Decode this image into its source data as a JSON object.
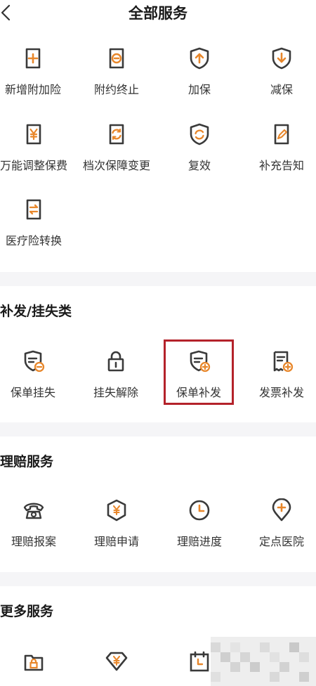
{
  "header": {
    "title": "全部服务",
    "back_icon": "chevron-left-icon"
  },
  "colors": {
    "accent": "#e8872b",
    "icon_stroke": "#3a3a3a",
    "highlight": "#b4222a",
    "divider": "#f5f5f7"
  },
  "change_section": {
    "items": [
      {
        "label": "新增附加险",
        "icon": "plus-doc-icon"
      },
      {
        "label": "附约终止",
        "icon": "minus-doc-icon"
      },
      {
        "label": "加保",
        "icon": "shield-up-icon"
      },
      {
        "label": "减保",
        "icon": "shield-down-icon"
      },
      {
        "label": "万能调整保费",
        "icon": "yen-doc-icon"
      },
      {
        "label": "档次保障变更",
        "icon": "cycle-doc-icon"
      },
      {
        "label": "复效",
        "icon": "shield-refresh-icon"
      },
      {
        "label": "补充告知",
        "icon": "pen-doc-icon"
      },
      {
        "label": "医疗险转换",
        "icon": "swap-doc-icon"
      }
    ]
  },
  "reissue_section": {
    "title": "补发/挂失类",
    "items": [
      {
        "label": "保单挂失",
        "icon": "policy-minus-icon"
      },
      {
        "label": "挂失解除",
        "icon": "unlock-icon"
      },
      {
        "label": "保单补发",
        "icon": "policy-plus-icon"
      },
      {
        "label": "发票补发",
        "icon": "invoice-plus-icon"
      }
    ]
  },
  "claims_section": {
    "title": "理赔服务",
    "items": [
      {
        "label": "理赔报案",
        "icon": "phone-icon"
      },
      {
        "label": "理赔申请",
        "icon": "yen-shield-icon"
      },
      {
        "label": "理赔进度",
        "icon": "clock-icon"
      },
      {
        "label": "定点医院",
        "icon": "location-plus-icon"
      }
    ]
  },
  "more_section": {
    "title": "更多服务",
    "items": [
      {
        "label": "",
        "icon": "folder-lock-icon"
      },
      {
        "label": "",
        "icon": "yen-diamond-icon"
      },
      {
        "label": "",
        "icon": "calendar-icon"
      }
    ]
  }
}
